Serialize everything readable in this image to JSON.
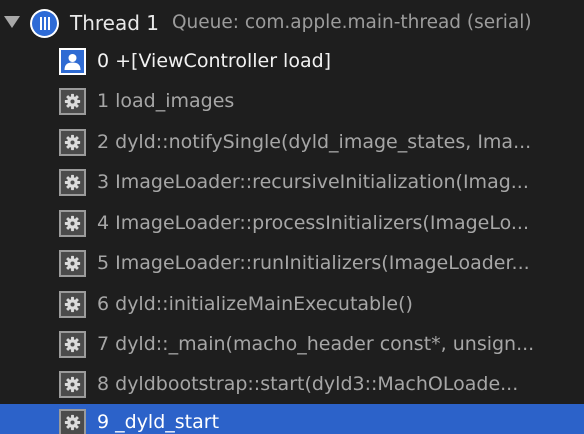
{
  "thread": {
    "disclosure_icon": "disclosure-triangle-expanded",
    "icon": "thread-icon",
    "title": "Thread 1",
    "queue": "Queue: com.apple.main-thread (serial)"
  },
  "frames": [
    {
      "label": "0 +[ViewController load]",
      "icon": "user-frame-icon",
      "kind": "user"
    },
    {
      "label": "1 load_images",
      "icon": "system-frame-gear-icon",
      "kind": "system"
    },
    {
      "label": "2 dyld::notifySingle(dyld_image_states, Ima...",
      "icon": "system-frame-gear-icon",
      "kind": "system"
    },
    {
      "label": "3 ImageLoader::recursiveInitialization(Imag...",
      "icon": "system-frame-gear-icon",
      "kind": "system"
    },
    {
      "label": "4 ImageLoader::processInitializers(ImageLo...",
      "icon": "system-frame-gear-icon",
      "kind": "system"
    },
    {
      "label": "5 ImageLoader::runInitializers(ImageLoader...",
      "icon": "system-frame-gear-icon",
      "kind": "system"
    },
    {
      "label": "6 dyld::initializeMainExecutable()",
      "icon": "system-frame-gear-icon",
      "kind": "system"
    },
    {
      "label": "7 dyld::_main(macho_header const*, unsign...",
      "icon": "system-frame-gear-icon",
      "kind": "system"
    },
    {
      "label": "8 dyldbootstrap::start(dyld3::MachOLoade...",
      "icon": "system-frame-gear-icon",
      "kind": "system"
    },
    {
      "label": "9 _dyld_start",
      "icon": "system-frame-gear-icon",
      "kind": "system",
      "selected": true
    }
  ],
  "colors": {
    "background": "#1e1e1e",
    "selection": "#2c62c9",
    "thread_icon": "#2e6bd6"
  }
}
